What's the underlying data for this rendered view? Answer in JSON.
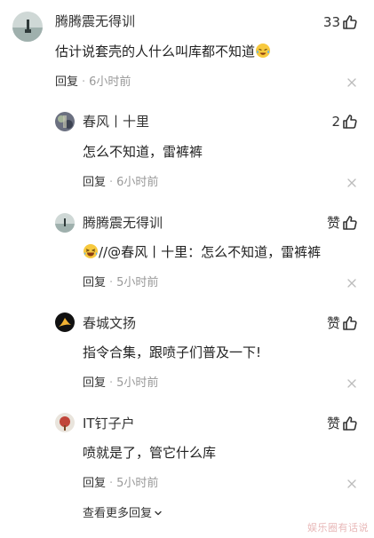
{
  "comments": [
    {
      "user": "腾腾震无得训",
      "likes": "33",
      "text": "估计说套壳的人什么叫库都不知道",
      "text_emoji": "smiling-face-with-tear",
      "reply_label": "回复",
      "separator": "·",
      "time": "6小时前"
    }
  ],
  "replies": [
    {
      "user": "春风丨十里",
      "likes": "2",
      "text": "怎么不知道，雷裤裤",
      "reply_label": "回复",
      "separator": "·",
      "time": "6小时前"
    },
    {
      "user": "腾腾震无得训",
      "likes": "赞",
      "text_prefix_emoji": "laughing-face",
      "text": "//@春风丨十里：怎么不知道，雷裤裤",
      "reply_label": "回复",
      "separator": "·",
      "time": "5小时前"
    },
    {
      "user": "春城文扬",
      "likes": "赞",
      "text": "指令合集，跟喷子们普及一下!",
      "reply_label": "回复",
      "separator": "·",
      "time": "5小时前"
    },
    {
      "user": "IT钉子户",
      "likes": "赞",
      "text": "喷就是了，管它什么库",
      "reply_label": "回复",
      "separator": "·",
      "time": "5小时前"
    }
  ],
  "more_replies": "查看更多回复",
  "watermark": "娱乐圈有话说",
  "icons": {
    "like": "thumbs-up-icon",
    "close": "close-icon",
    "expand": "chevron-down-icon"
  },
  "colors": {
    "text": "#222222",
    "meta": "#999999",
    "icon": "#333333"
  }
}
